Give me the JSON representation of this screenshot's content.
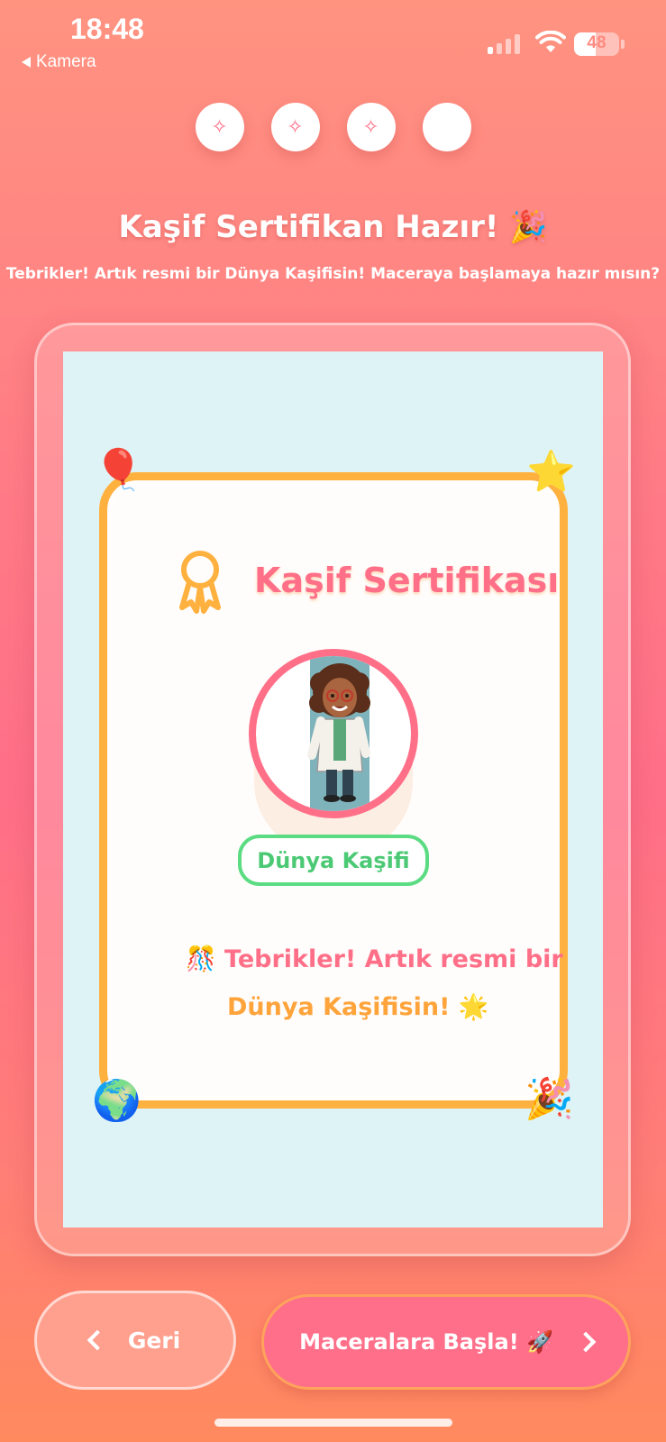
{
  "status_bar": {
    "time": "18:48",
    "back_app": "Kamera",
    "battery": "48",
    "battery_level": 0.48
  },
  "steps": [
    {
      "icon": "sparkles-icon",
      "glyph": "✧",
      "done": true
    },
    {
      "icon": "sparkles-icon",
      "glyph": "✧",
      "done": true
    },
    {
      "icon": "sparkles-icon",
      "glyph": "✧",
      "done": true
    },
    {
      "icon": "empty-circle",
      "glyph": "",
      "done": false
    }
  ],
  "header": {
    "title": "Kaşif Sertifikan Hazır! 🎉",
    "subtitle": "Tebrikler! Artık resmi bir Dünya Kaşifisin! Maceraya başlamaya hazır mısın?"
  },
  "certificate": {
    "title": "Kaşif Sertifikası",
    "badge": "Dünya Kaşifi",
    "message_line1": "🎊 Tebrikler! Artık resmi bir",
    "message_line2": "Dünya Kaşifisin! 🌟",
    "corners": {
      "top_left": "🎈",
      "top_right": "⭐",
      "bottom_left": "🌍",
      "bottom_right": "🎉"
    },
    "colors": {
      "border": "#ffb13f",
      "title": "#ff6f88",
      "badge": "#4cc975"
    }
  },
  "buttons": {
    "back": "Geri",
    "start": "Maceralara Başla! 🚀"
  }
}
